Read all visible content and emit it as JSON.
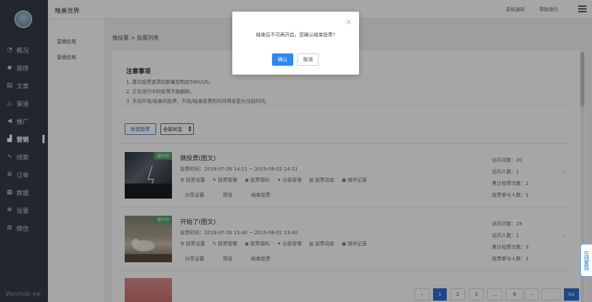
{
  "sidebar": {
    "items": [
      {
        "icon": "meter-icon",
        "glyph": "◔",
        "label": "概况"
      },
      {
        "icon": "brush-icon",
        "glyph": "◆",
        "label": "装修"
      },
      {
        "icon": "document-icon",
        "glyph": "▤",
        "label": "文章"
      },
      {
        "icon": "bell-icon",
        "glyph": "△",
        "label": "渠道"
      },
      {
        "icon": "megaphone-icon",
        "glyph": "◀",
        "label": "推广"
      },
      {
        "icon": "chart-icon",
        "glyph": "▟",
        "label": "营销"
      },
      {
        "icon": "line-chart-icon",
        "glyph": "∿",
        "label": "线索"
      },
      {
        "icon": "list-icon",
        "glyph": "≣",
        "label": "订单"
      },
      {
        "icon": "database-icon",
        "glyph": "▦",
        "label": "数据"
      },
      {
        "icon": "gear-icon",
        "glyph": "✻",
        "label": "设置"
      },
      {
        "icon": "mini-app-icon",
        "glyph": "⊞",
        "label": "微信"
      }
    ],
    "active_index": 5,
    "brand": "Weimob",
    "brand_sub": "微盟"
  },
  "header": {
    "title": "唯美世界",
    "links": [
      "系统通知",
      "帮助指引"
    ]
  },
  "subnav": {
    "items": [
      "营销应用",
      "营销应用"
    ]
  },
  "breadcrumb": "微投票 > 投票列表",
  "notes": {
    "title": "注意事项",
    "items": [
      "1. 建议投票选项的数量控制在500以内。",
      "2. 正在进行中的投票不能删除。",
      "3. 手动开始/结束的投票，开始/结束投票的时间将变更为当前时间。"
    ]
  },
  "toolbar": {
    "new_label": "新建投票",
    "filter_value": "全部状态"
  },
  "votes": [
    {
      "badge": "进行中",
      "title": "微投票(图文)",
      "time": "投票时间：2019-07-26 14:11 ~ 2019-08-02 14:11",
      "stats": [
        "访问次数：20",
        "访问人数：1",
        "累计投票次数：1",
        "投票参与人数：1"
      ]
    },
    {
      "badge": "进行中",
      "title": "开始了(图文)",
      "time": "投票时间：2019-07-26 13:40 ~ 2019-08-02 13:40",
      "stats": [
        "访问次数：19",
        "访问人数：1",
        "累计投票次数：3",
        "投票参与人数：1"
      ]
    }
  ],
  "vote_actions": [
    {
      "icon": "gear-icon",
      "glyph": "⚙",
      "label": "投票设置"
    },
    {
      "icon": "edit-icon",
      "glyph": "✎",
      "label": "投票管理"
    },
    {
      "icon": "eye-icon",
      "glyph": "◉",
      "label": "投票福利"
    },
    {
      "icon": "announce-icon",
      "glyph": "✦",
      "label": "公告管理"
    },
    {
      "icon": "bar-chart-icon",
      "glyph": "▥",
      "label": "投票动态"
    },
    {
      "icon": "calendar-icon",
      "glyph": "▣",
      "label": "操作记录"
    }
  ],
  "vote_links": [
    "分享设置",
    "预览",
    "结束投票"
  ],
  "pagination": {
    "prev": "‹",
    "pages": [
      "1",
      "2",
      "3",
      "...",
      "9"
    ],
    "next": "›",
    "go": "Go"
  },
  "online_service": "在线客服",
  "modal": {
    "message": "结束后不可再开启。您确认结束投票?",
    "confirm": "确认",
    "cancel": "取消",
    "close": "×"
  },
  "colors": {
    "sidebar": "#353b4c",
    "primary": "#2d89ef",
    "badge": "#5aa468"
  }
}
